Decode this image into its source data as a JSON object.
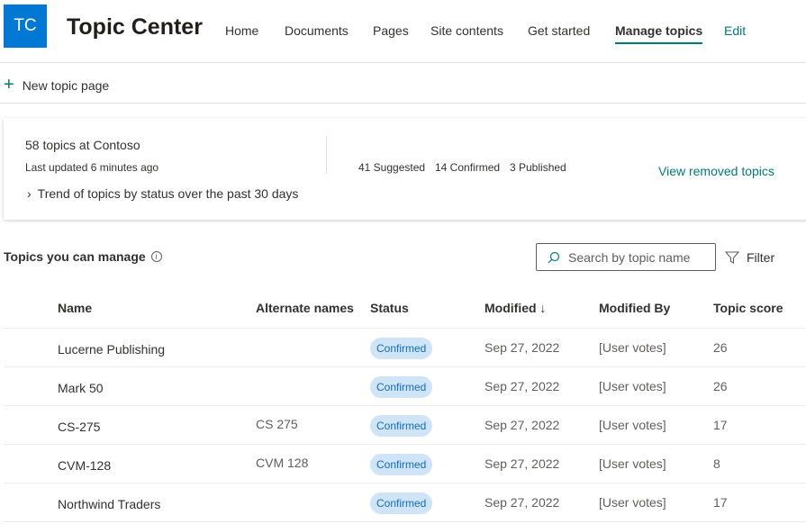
{
  "site": {
    "logo_initials": "TC",
    "title": "Topic Center",
    "brand_color": "#0078d4",
    "accent_color": "#03787c"
  },
  "nav": [
    "Home",
    "Documents",
    "Pages",
    "Site contents",
    "Get started",
    "Manage topics",
    "Edit"
  ],
  "command": {
    "new_topic_label": "New topic page"
  },
  "summary": {
    "count": "58 topics at Contoso",
    "updated": "Last updated 6 minutes ago",
    "trend": "Trend of topics by status over the past 30 days",
    "suggested": "41 Suggested",
    "confirmed": "14 Confirmed",
    "published": "3 Published",
    "view_removed": "View removed topics"
  },
  "list": {
    "heading": "Topics you can manage",
    "search_placeholder": "Search by topic name",
    "filter_label": "Filter",
    "columns": [
      "Name",
      "Alternate names",
      "Status",
      "Modified ↓",
      "Modified By",
      "Topic score"
    ],
    "rows": [
      {
        "name": "Lucerne Publishing",
        "alt": "",
        "status": "Confirmed",
        "modified": "Sep 27, 2022",
        "by": "[User votes]",
        "score": "26"
      },
      {
        "name": "Mark 50",
        "alt": "",
        "status": "Confirmed",
        "modified": "Sep 27, 2022",
        "by": "[User votes]",
        "score": "26"
      },
      {
        "name": "CS-275",
        "alt": "CS 275",
        "status": "Confirmed",
        "modified": "Sep 27, 2022",
        "by": "[User votes]",
        "score": "17"
      },
      {
        "name": "CVM-128",
        "alt": "CVM 128",
        "status": "Confirmed",
        "modified": "Sep 27, 2022",
        "by": "[User votes]",
        "score": "8"
      },
      {
        "name": "Northwind Traders",
        "alt": "",
        "status": "Confirmed",
        "modified": "Sep 27, 2022",
        "by": "[User votes]",
        "score": "17"
      }
    ]
  }
}
